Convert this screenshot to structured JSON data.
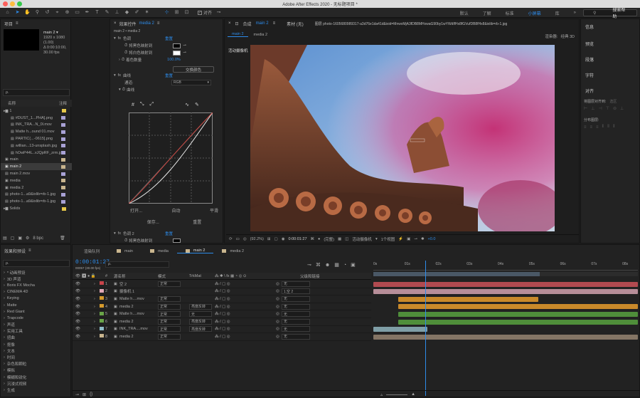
{
  "window_title": "Adobe After Effects 2020 - 无标题项目 *",
  "workspaces": [
    "默认",
    "了解",
    "标准",
    "小屏幕",
    "库"
  ],
  "active_workspace": "小屏幕",
  "help_search_placeholder": "搜索帮助",
  "snap_label": "对齐",
  "project": {
    "tab": "项目",
    "comp_name": "main 2 ▾",
    "comp_size": "1920 x 1080 (1.00)",
    "comp_duration": "Δ 0:00:10:00, 30.00 fps",
    "search_placeholder": "ρ.",
    "col_name": "名称",
    "col_note": "注释",
    "items": [
      {
        "name": "1",
        "type": "folder",
        "color": "#e7c84a"
      },
      {
        "name": "#DUST_1...PHA].png",
        "type": "file",
        "color": "#a9a2d6"
      },
      {
        "name": "INK_TRA...N_0l.mov",
        "type": "file",
        "color": "#a9a2d6"
      },
      {
        "name": "Matte h...ound 01.mov",
        "type": "file",
        "color": "#a9a2d6"
      },
      {
        "name": "PARTIC(...-0615].png",
        "type": "file",
        "color": "#a9a2d6"
      },
      {
        "name": "willian...13-unsplash.jpg",
        "type": "file",
        "color": "#a9a2d6"
      },
      {
        "name": "hOwP44L..xJQpRF_zrm.jpg",
        "type": "file",
        "color": "#a9a2d6"
      },
      {
        "name": "main",
        "type": "comp",
        "color": "#c9b58e"
      },
      {
        "name": "main 2",
        "type": "comp",
        "color": "#c9b58e"
      },
      {
        "name": "main 2.mov",
        "type": "file",
        "color": "#a9a2d6"
      },
      {
        "name": "media",
        "type": "comp",
        "color": "#c9b58e"
      },
      {
        "name": "media 2",
        "type": "comp",
        "color": "#c9b58e"
      },
      {
        "name": "photo-1...a9&ixlib=rb-1.jpg",
        "type": "file",
        "color": "#a9a2d6"
      },
      {
        "name": "photo-1...a9&ixlib=rb-1.jpg",
        "type": "file",
        "color": "#a9a2d6"
      },
      {
        "name": "Solids",
        "type": "folder",
        "color": "#e7c84a"
      }
    ],
    "bpc": "8 bpc"
  },
  "effects": {
    "tab": "效果控件",
    "tab_layer": "media 2",
    "breadcrumb": "main 2 • media 2",
    "fx1_name": "色调",
    "reset": "重置",
    "map_black": "将黑色映射到",
    "map_white": "将白色映射到",
    "amount_label": "着色数量",
    "amount_value": "100.0%",
    "swap_btn": "交换颜色",
    "fx2_name": "曲线",
    "reset2": "重置",
    "channel_label": "通道:",
    "channel_value": "RGB",
    "curves_label": "曲线",
    "open_btn": "打开...",
    "auto_btn": "自动",
    "smooth_btn": "平滑",
    "save_btn": "保存...",
    "reset_btn": "重置",
    "fx3_name": "色调 2",
    "reset3": "重置",
    "map_black2": "将黑色映射到",
    "map_white2": "将白色映射到"
  },
  "composition": {
    "panel_label": "合成",
    "panel_name": "main 2",
    "footage_label": "素材 (无)",
    "layer_label": "图层 photo-1605680989317-a3d76e1da41d&ixid=MnwxMjA3fDB8MHxwaG90by1wYWdlfHx8fGVufDB8fHx8&ixlib=rb-1.jpg",
    "renderer_label": "渲染器:",
    "renderer_value": "经典 3D",
    "tabs": [
      "main 2",
      "media 2"
    ],
    "camera_label": "活动摄像机",
    "zoom": "(92.2%)",
    "timecode": "0:00:01:27",
    "quality": "(完整)",
    "camera_select": "活动摄像机",
    "views": "1个视图",
    "exposure": "+0.0"
  },
  "right_panel": {
    "items": [
      "信息",
      "预览",
      "段落",
      "字符",
      "对齐"
    ],
    "align_to": "将图层对齐到:",
    "align_sel": "选区",
    "distribute": "分布图层:"
  },
  "effects_presets": {
    "tab": "效果和预设",
    "search_placeholder": "ρ.",
    "items": [
      "* 动画预设",
      "3D 声道",
      "Boris FX Mocha",
      "CINEMA 4D",
      "Keying",
      "Matte",
      "Red Giant",
      "Trapcode",
      "声道",
      "实用工具",
      "扭曲",
      "抠像",
      "文本",
      "时间",
      "杂色和颗粒",
      "模拟",
      "模糊和锐化",
      "沉浸式视频",
      "生成"
    ]
  },
  "timeline": {
    "tabs": [
      "渲染队列",
      "main",
      "media",
      "main 2",
      "media 2"
    ],
    "active_tab": "main 2",
    "timecode": "0:00:01:27",
    "frames": "00057 (30.00 fps)",
    "search_placeholder": "ρ.",
    "col_layer": "源名称",
    "col_mode": "模式",
    "col_trkmat": "TrkMat",
    "col_parent": "父级和链接",
    "col_num": "#",
    "ruler": [
      "0s",
      "01s",
      "02s",
      "03s",
      "04s",
      "05s",
      "06s",
      "07s",
      "08s"
    ],
    "playhead_fraction": 0.195,
    "layers": [
      {
        "num": "1",
        "name": "空 2",
        "label": "#c9444a",
        "mode": "正常",
        "trk": "",
        "parent": "无",
        "start": 0.0,
        "end": 1.0,
        "bar": "#b14a50"
      },
      {
        "num": "2",
        "name": "摄像机 1",
        "label": "#e0a8b6",
        "mode": "",
        "trk": "",
        "parent": "1.空 2",
        "start": 0.0,
        "end": 1.0,
        "bar": "#b78e99"
      },
      {
        "num": "3",
        "name": "Matte h....mov",
        "label": "#d69a2c",
        "mode": "正常",
        "trk": "",
        "parent": "无",
        "start": 0.095,
        "end": 0.625,
        "bar": "#c9892a"
      },
      {
        "num": "4",
        "name": "media 2",
        "label": "#d69a2c",
        "mode": "正常",
        "trk": "亮度反转",
        "parent": "无",
        "start": 0.095,
        "end": 1.0,
        "bar": "#c9892a"
      },
      {
        "num": "5",
        "name": "Matte h....mov",
        "label": "#69a548",
        "mode": "正常",
        "trk": "无",
        "parent": "无",
        "start": 0.095,
        "end": 1.0,
        "bar": "#4f8e3a"
      },
      {
        "num": "6",
        "name": "media 2",
        "label": "#69a548",
        "mode": "正常",
        "trk": "亮度反转",
        "parent": "无",
        "start": 0.095,
        "end": 1.0,
        "bar": "#4f8e3a"
      },
      {
        "num": "7",
        "name": "INK_TRA....mov",
        "label": "#8fbcc8",
        "mode": "正常",
        "trk": "亮度反转",
        "parent": "无",
        "start": 0.0,
        "end": 0.205,
        "bar": "#7f9ea6"
      },
      {
        "num": "8",
        "name": "media 2",
        "label": "#c9b58e",
        "mode": "正常",
        "trk": "",
        "parent": "无",
        "start": 0.0,
        "end": 1.0,
        "bar": "#847565"
      }
    ]
  },
  "colors": {
    "accent": "#2d8ceb"
  }
}
